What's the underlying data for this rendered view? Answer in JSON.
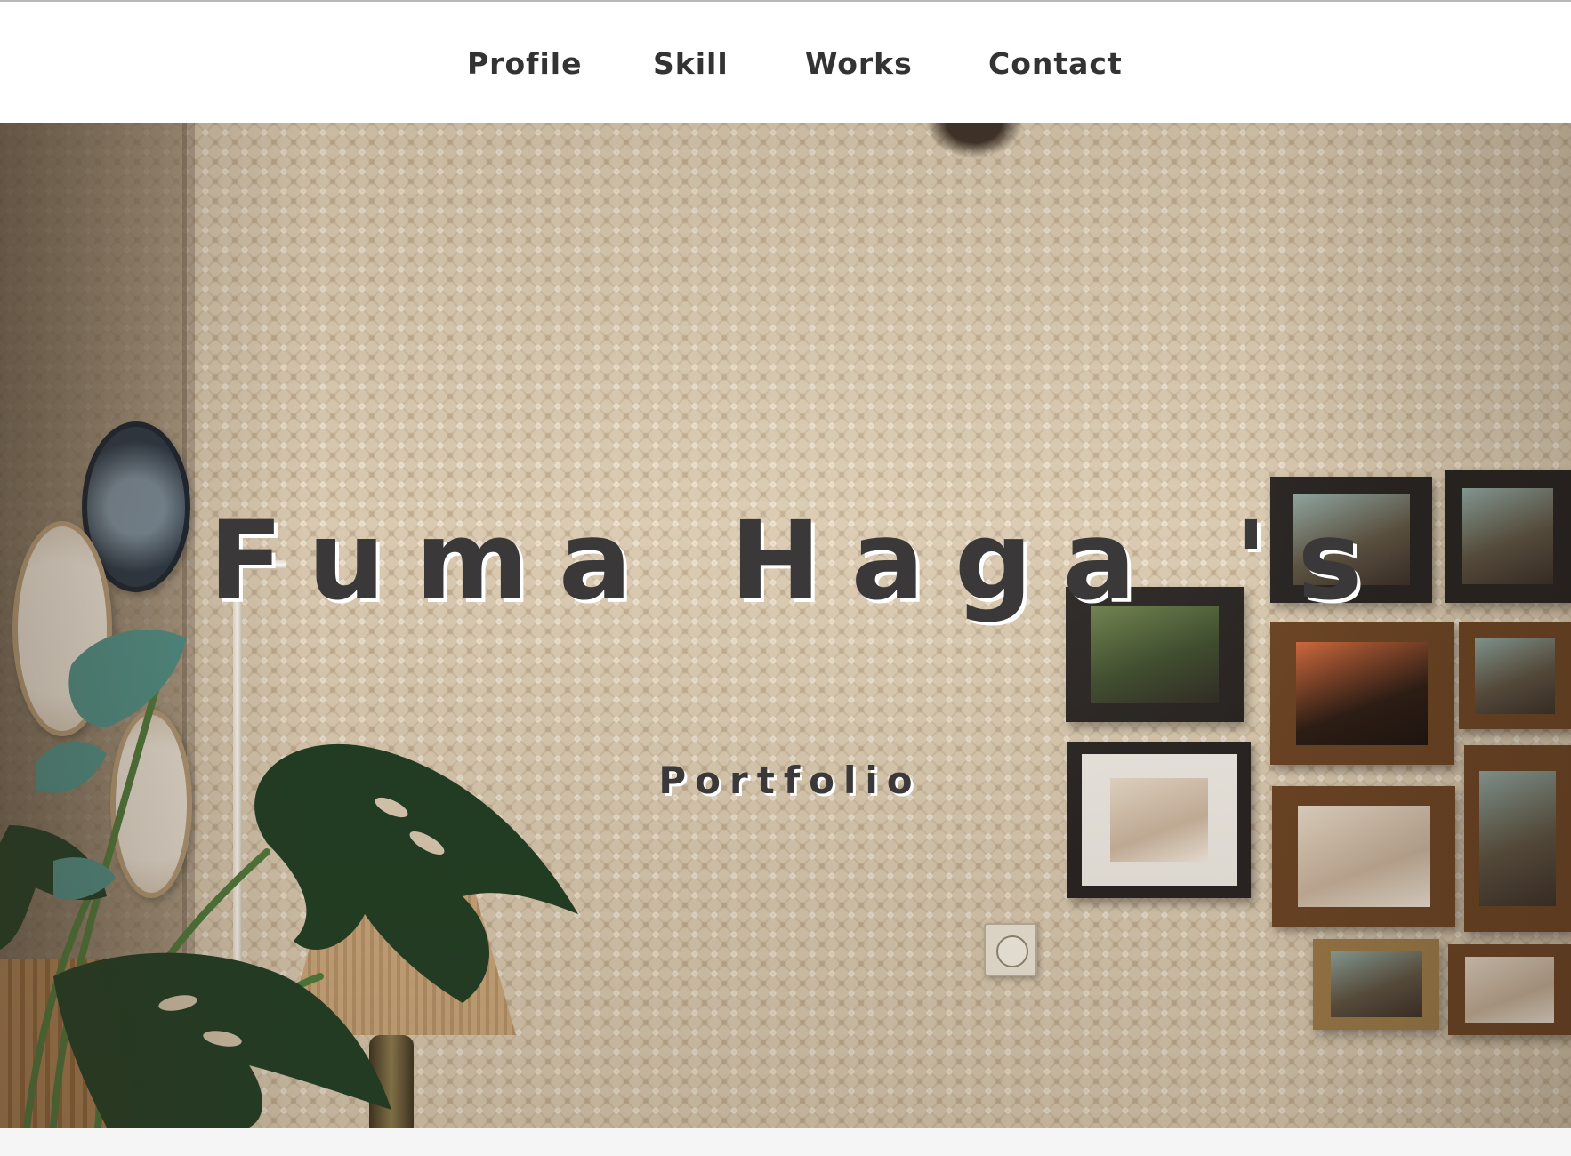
{
  "nav": {
    "items": [
      {
        "label": "Profile"
      },
      {
        "label": "Skill"
      },
      {
        "label": "Works"
      },
      {
        "label": "Contact"
      }
    ]
  },
  "hero": {
    "title": "Fuma Haga 's",
    "subtitle": "Portfolio"
  },
  "colors": {
    "nav_text": "#333333",
    "title_text": "#3a3838",
    "title_shadow": "#ffffff",
    "header_bg": "#ffffff"
  }
}
